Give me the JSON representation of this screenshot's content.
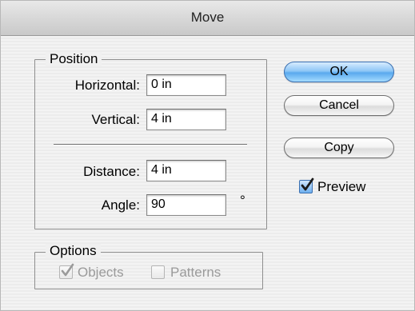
{
  "window": {
    "title": "Move"
  },
  "position": {
    "legend": "Position",
    "horizontal": {
      "label": "Horizontal:",
      "value": "0 in"
    },
    "vertical": {
      "label": "Vertical:",
      "value": "4 in"
    },
    "distance": {
      "label": "Distance:",
      "value": "4 in"
    },
    "angle": {
      "label": "Angle:",
      "value": "90",
      "unit": "°"
    }
  },
  "options": {
    "legend": "Options",
    "objects": {
      "label": "Objects",
      "checked": true,
      "enabled": false
    },
    "patterns": {
      "label": "Patterns",
      "checked": false,
      "enabled": false
    }
  },
  "buttons": {
    "ok": "OK",
    "cancel": "Cancel",
    "copy": "Copy"
  },
  "preview": {
    "label": "Preview",
    "checked": true
  },
  "colors": {
    "default_button": "#5aa9ee",
    "check_accent": "#3a6fb0"
  }
}
